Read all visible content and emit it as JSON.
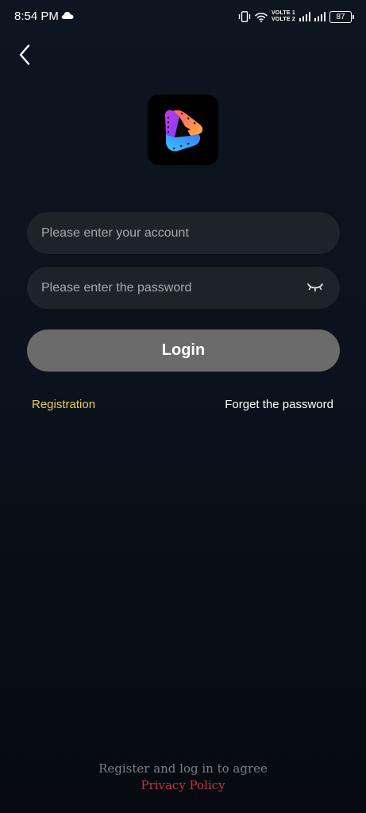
{
  "status_bar": {
    "time": "8:54 PM",
    "volte_1": "VOLTE 1",
    "volte_2": "VOLTE 2",
    "battery": "87"
  },
  "login_form": {
    "account_placeholder": "Please enter your account",
    "password_placeholder": "Please enter the password",
    "login_label": "Login",
    "registration_label": "Registration",
    "forget_password_label": "Forget the password"
  },
  "footer": {
    "agree_text": "Register and log in to agree",
    "privacy_label": "Privacy Policy"
  },
  "colors": {
    "background": "#0b121b",
    "field_background": "#1e2229",
    "login_button": "#6b6b6b",
    "registration_link": "#e8cf5a",
    "privacy_link": "#c8323f"
  },
  "icons": [
    "cloud-icon",
    "vibrate-icon",
    "wifi-icon",
    "signal-icon",
    "back-arrow-icon",
    "app-logo-icon",
    "eye-closed-icon"
  ]
}
